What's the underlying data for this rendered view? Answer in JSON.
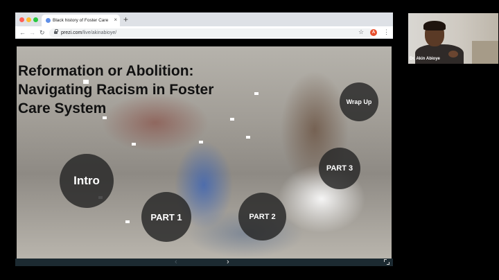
{
  "browser": {
    "tab_title": "Black history of Foster Care | P",
    "tab_close": "×",
    "new_tab": "+",
    "url_host": "prezi.com",
    "url_path": "/live/akinabioye/",
    "profile_initial": "A",
    "nav": {
      "back": "←",
      "forward": "→",
      "reload": "↻",
      "star": "☆",
      "menu": "⋮"
    }
  },
  "slide": {
    "title": "Reformation or Abolition: Navigating Racism in Foster Care System",
    "topics": {
      "intro": "Intro",
      "part1": "PART 1",
      "part2": "PART 2",
      "part3": "PART 3",
      "wrap_up": "Wrap Up"
    }
  },
  "controls": {
    "prev": "‹",
    "next": "›"
  },
  "webcam": {
    "name": "Dr. Akin Abioye"
  },
  "icons": {
    "tab_favicon": "globe-icon",
    "lock": "lock-icon",
    "star": "star-icon",
    "fullscreen": "fullscreen-icon"
  },
  "colors": {
    "bottom_bar": "#1c2a31",
    "topic_circle": "#262626",
    "profile": "#e8502e"
  }
}
